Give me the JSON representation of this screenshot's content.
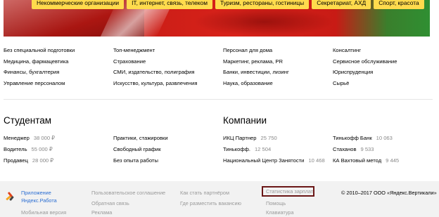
{
  "banner": {
    "chips": [
      "Некоммерческие организации",
      "IT, интернет, связь, телеком",
      "Туризм, рестораны, гостиницы",
      "Секретариат, АХД",
      "Спорт, красота"
    ]
  },
  "categories": {
    "col1": [
      "Без специальной подготовки",
      "Медицина, фармацевтика",
      "Финансы, бухгалтерия",
      "Управление персоналом"
    ],
    "col2": [
      "Топ-менеджмент",
      "Страхование",
      "СМИ, издательство, полиграфия",
      "Искусство, культура, развлечения"
    ],
    "col3": [
      "Персонал для дома",
      "Маркетинг, реклама, PR",
      "Банки, инвестиции, лизинг",
      "Наука, образование"
    ],
    "col4": [
      "Консалтинг",
      "Сервисное обслуживание",
      "Юриспруденция",
      "Сырьё"
    ]
  },
  "students": {
    "title": "Студентам",
    "salaries": [
      {
        "name": "Менеджер",
        "value": "38 000 ₽"
      },
      {
        "name": "Водитель",
        "value": "55 000 ₽"
      },
      {
        "name": "Продавец",
        "value": "28 000 ₽"
      }
    ],
    "links": [
      "Практики, стажировки",
      "Свободный график",
      "Без опыта работы"
    ]
  },
  "companies": {
    "title": "Компании",
    "left": [
      {
        "name": "ИКЦ Партнер",
        "value": "25 750"
      },
      {
        "name": "Тинькофф.",
        "value": "12 504"
      },
      {
        "name": "Национальный Центр Занятости",
        "value": "10 468"
      }
    ],
    "right": [
      {
        "name": "Тинькофф Банк",
        "value": "10 063"
      },
      {
        "name": "Стаханов",
        "value": "9 533"
      },
      {
        "name": "КА Вахтовый метод",
        "value": "9 445"
      }
    ]
  },
  "footer": {
    "app_line1": "Приложение",
    "app_line2": "Яндекс.Работа",
    "mobile": "Мобильная версия",
    "agreement": "Пользовательское соглашение",
    "feedback": "Обратная связь",
    "ads": "Реклама",
    "partner": "Как стать партнёром",
    "where_post": "Где разместить вакансию",
    "salary_stats": "Статистика зарплат",
    "help": "Помощь",
    "keyboard": "Клавиатура",
    "copyright": "© 2010–2017  ООО «Яндекс.Вертикали»"
  },
  "colors": {
    "chip": "#ffdb4d",
    "link_blue": "#2b6ed2",
    "highlight_border": "#6a1616",
    "footer_bg": "#f2f2f2"
  }
}
